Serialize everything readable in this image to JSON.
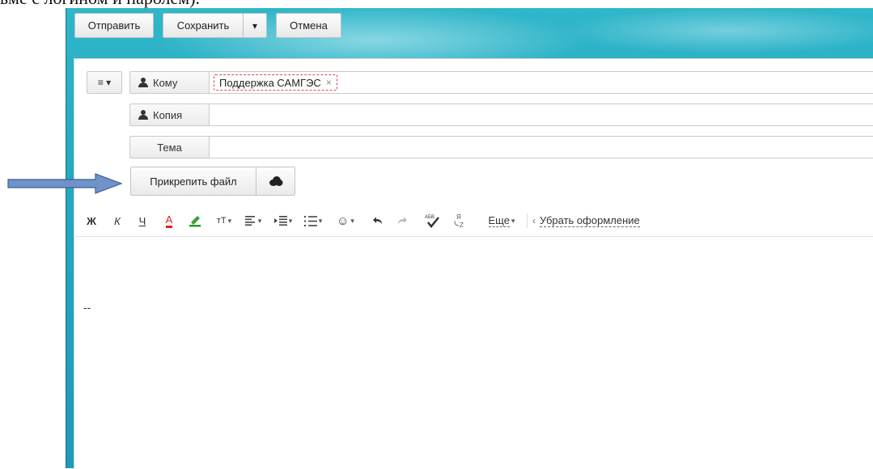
{
  "doc": {
    "top_text": "ьме с логином и паролем)."
  },
  "toolbar": {
    "send_label": "Отправить",
    "save_label": "Сохранить",
    "save_dropdown_glyph": "▾",
    "cancel_label": "Отмена"
  },
  "compose": {
    "menu_glyph": "≡ ▾",
    "to_label": "Кому",
    "to_recipient": "Поддержка САМГЭС",
    "chip_remove": "×",
    "cc_label": "Копия",
    "subject_label": "Тема",
    "subject_value": "",
    "cc_value": "",
    "attach_label": "Прикрепить файл",
    "signature": "--"
  },
  "format_toolbar": {
    "bold": "Ж",
    "italic": "К",
    "underline": "Ч",
    "text_color": "А",
    "font_size": "тТ",
    "more_label": "Еще",
    "remove_format_label": "Убрать оформление",
    "remove_format_arrow": "‹"
  },
  "colors": {
    "window_bg": "#26a7c0",
    "arrow_fill": "#6f93c9",
    "arrow_stroke": "#3d5f94",
    "chip_border": "#d05050",
    "text_color_underline": "#d22",
    "highlight_green": "#2a9a2a"
  },
  "icons": {
    "person": "person-icon",
    "cloud": "cloud-icon",
    "arrow": "arrow-pointer-icon"
  }
}
